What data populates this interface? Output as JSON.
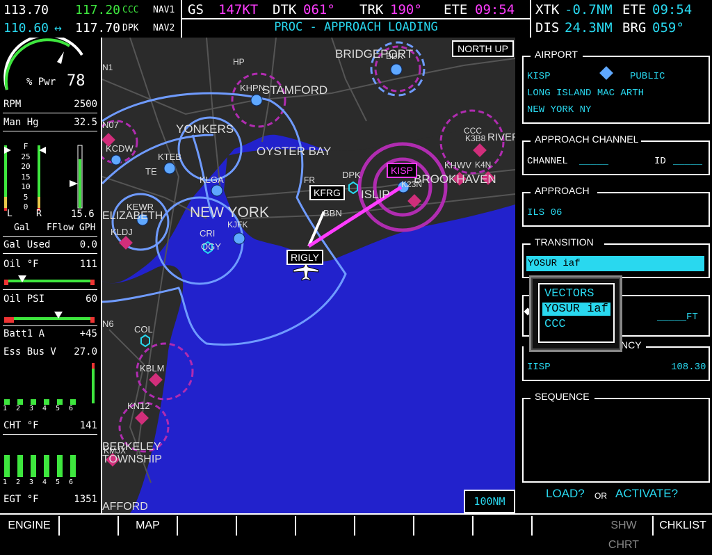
{
  "top": {
    "nav1_active": "113.70",
    "nav1_standby": "117.20",
    "nav1_ident": "CCC",
    "nav1_label": "NAV1",
    "nav2_active": "110.60",
    "nav2_swap": "↔",
    "nav2_standby": "117.70",
    "nav2_ident": "DPK",
    "nav2_label": "NAV2",
    "gs_label": "GS",
    "gs_value": "147KT",
    "dtk_label": "DTK",
    "dtk_value": "061°",
    "trk_label": "TRK",
    "trk_value": "190°",
    "ete_label": "ETE",
    "ete_value": "09:54",
    "status": "PROC - APPROACH LOADING",
    "xtk_label": "XTK",
    "xtk_value": "-0.7NM",
    "ete2_label": "ETE",
    "ete2_value": "09:54",
    "dis_label": "DIS",
    "dis_value": "24.3NM",
    "brg_label": "BRG",
    "brg_value": "059°"
  },
  "engine": {
    "pwr_label": "% Pwr",
    "pwr_value": "78",
    "pwr_fraction": 0.78,
    "rpm_label": "RPM",
    "rpm_value": "2500",
    "manhg_label": "Man Hg",
    "manhg_value": "32.5",
    "fuel_scale": [
      "F",
      "25",
      "20",
      "15",
      "10",
      "5",
      "0"
    ],
    "fuel_left_label": "L",
    "fuel_right_label": "R",
    "fuel_flow_value": "15.6",
    "fuel_units_label": "Gal   FFlow GPH",
    "gal_used_label": "Gal Used",
    "gal_used_value": "0.0",
    "oil_temp_label": "Oil °F",
    "oil_temp_value": "111",
    "oil_psi_label": "Oil PSI",
    "oil_psi_value": "60",
    "batt_label": "Batt1 A",
    "batt_value": "+45",
    "essbus_label": "Ess Bus V",
    "essbus_value": "27.0",
    "cyl_numbers": [
      "1",
      "2",
      "3",
      "4",
      "5",
      "6"
    ],
    "cht_label": "CHT °F",
    "cht_value": "141",
    "egt_label": "EGT °F",
    "egt_value": "1351"
  },
  "map": {
    "orientation": "NORTH UP",
    "range": "100NM",
    "labels": {
      "bridgeport": "BRIDGEPORT",
      "bdr": "BDR",
      "stamford": "STAMFORD",
      "khpn": "KHPN",
      "hp": "HP",
      "yonkers": "YONKERS",
      "oyster_bay": "OYSTER BAY",
      "new_york": "NEW YORK",
      "islip": "ISLIP",
      "n07": "N07",
      "kcdw": "KCDW",
      "kteb": "KTEB",
      "te": "TE",
      "klga": "KLGA",
      "kewr": "KEWR",
      "elizabeth": "ELIZABETH",
      "kldj": "KLDJ",
      "cri": "CRI",
      "kjfk": "KJFK",
      "ogy": "OGY",
      "fr": "FR",
      "dpk": "DPK",
      "bbn": "BBN",
      "k23n": "K23N",
      "brook": "BROOKHAVEN",
      "khwv": "KHWV",
      "k4n": "K4N",
      "ccc": "CCC",
      "k3b8": "K3B8",
      "riverhead": "RIVERHEAD",
      "n6": "N6",
      "col": "COL",
      "kblm": "KBLM",
      "kn12": "KN12",
      "berkeley": "BERKELEY",
      "township": "TOWNSHIP",
      "kmjx": "KMJX",
      "afford": "AFFORD",
      "n1": "N1"
    },
    "wpt_kfrg": "KFRG",
    "wpt_kisp": "KISP",
    "wpt_rigly": "RIGLY"
  },
  "panel": {
    "airport_title": "AIRPORT",
    "airport_id": "KISP",
    "airport_type": "PUBLIC",
    "airport_name": "LONG ISLAND MAC ARTH",
    "airport_city": "NEW YORK NY",
    "chan_title": "APPROACH CHANNEL",
    "chan_label": "CHANNEL",
    "chan_value": "_____",
    "id_label": "ID",
    "id_value": "_____",
    "appr_title": "APPROACH",
    "appr_value": "ILS 06",
    "trans_title": "TRANSITION",
    "trans_value": "YOSUR iaf",
    "popup_items": [
      "VECTORS",
      "YOSUR iaf",
      "CCC"
    ],
    "popup_selected": 1,
    "minimums_value": "_____FT",
    "freq_title_tail": "NCY",
    "freq_ident": "IISP",
    "freq_value": "108.30",
    "seq_title": "SEQUENCE",
    "load_label": "LOAD?",
    "or_label": "OR",
    "activate_label": "ACTIVATE?"
  },
  "softkeys": {
    "k1": "ENGINE",
    "k2": "",
    "k3": "MAP",
    "k4": "",
    "k5": "",
    "k6": "",
    "k7": "",
    "k8": "",
    "k9": "",
    "k10": "SHW CHRT",
    "k11": "CHKLIST"
  },
  "colors": {
    "cyan": "#29d8ef",
    "green": "#3ee63e",
    "magenta": "#ff3cff",
    "water": "#2222cc",
    "land": "#2a2a2a",
    "class_b": "#6f9bff"
  }
}
